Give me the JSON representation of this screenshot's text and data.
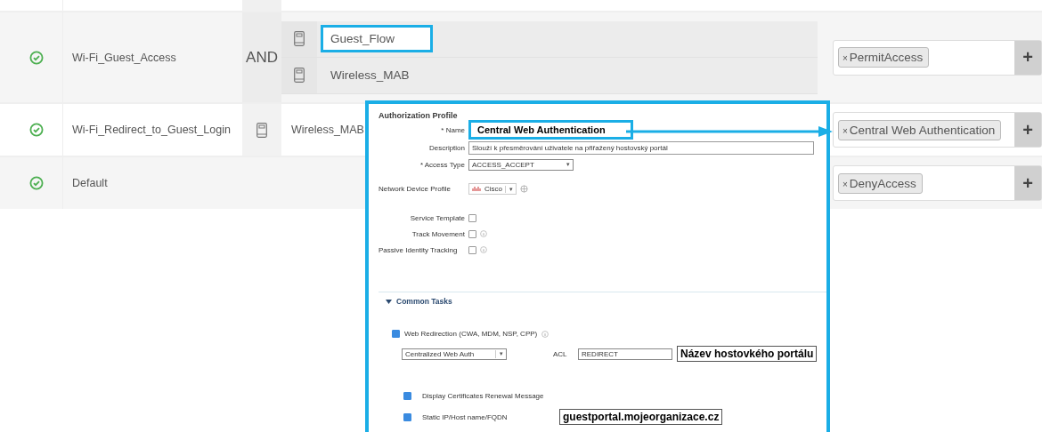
{
  "rules": [
    {
      "name": "Wi-Fi_Guest_Access",
      "operator": "AND",
      "conditions": [
        {
          "label": "Guest_Flow",
          "highlighted": true
        },
        {
          "label": "Wireless_MAB",
          "highlighted": false
        }
      ],
      "result": {
        "remove": "×",
        "tag": "PermitAccess",
        "add": "+"
      }
    },
    {
      "name": "Wi-Fi_Redirect_to_Guest_Login",
      "conditions": [
        {
          "label": "Wireless_MAB",
          "highlighted": false
        }
      ],
      "result": {
        "remove": "×",
        "tag": "Central Web Authentication",
        "add": "+"
      }
    },
    {
      "name": "Default",
      "result": {
        "remove": "×",
        "tag": "DenyAccess",
        "add": "+"
      }
    }
  ],
  "profile": {
    "title": "Authorization Profile",
    "fields": [
      {
        "kind": "callout",
        "label": "* Name",
        "value": "Central Web Authentication"
      },
      {
        "kind": "textarea",
        "label": "Description",
        "value": "Slouží k přesměrování uživatele na přiřažený hostovský portál"
      },
      {
        "kind": "select",
        "label": "* Access Type",
        "value": "ACCESS_ACCEPT",
        "caret": "▾"
      },
      {
        "kind": "device",
        "label": "Network Device Profile",
        "value": "Cisco",
        "caret": "▾"
      }
    ],
    "options": [
      {
        "label": "Service Template",
        "checked": false,
        "info": false
      },
      {
        "label": "Track Movement",
        "checked": false,
        "info": true
      },
      {
        "label": "Passive Identity Tracking",
        "checked": false,
        "info": true
      }
    ],
    "section": {
      "title": "Common Tasks",
      "expanded": true,
      "redirect": {
        "label": "Web Redirection (CWA, MDM, NSP, CPP)",
        "checked": true,
        "type": "Centralized Web Auth",
        "type_caret": "▾",
        "acl_label": "ACL",
        "acl": "REDIRECT",
        "portal_callout": "Název hostovkého portálu"
      },
      "sub_options": [
        {
          "label": "Display Certificates Renewal Message",
          "checked": true
        },
        {
          "label": "Static IP/Host name/FQDN",
          "checked": true,
          "callout": "guestportal.mojeorganizace.cz"
        }
      ]
    }
  }
}
